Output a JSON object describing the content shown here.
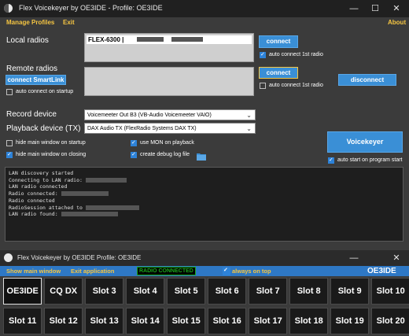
{
  "window1": {
    "title": "Flex Voicekeyer by OE3IDE - Profile: OE3IDE",
    "menu": {
      "manage_profiles": "Manage Profiles",
      "exit": "Exit",
      "about": "About"
    },
    "local_radios": {
      "label": "Local radios",
      "radio_entry": "FLEX-6300 |",
      "connect_label": "connect",
      "auto_connect_label": "auto connect 1st radio",
      "auto_connect_checked": true
    },
    "remote_radios": {
      "label": "Remote radios",
      "smartlink_label": "connect SmartLink",
      "auto_connect_startup_label": "auto connect on startup",
      "auto_connect_startup_checked": false,
      "connect_label": "connect",
      "auto_connect_label": "auto connect 1st radio",
      "auto_connect_checked": false,
      "disconnect_label": "disconnect"
    },
    "record_device": {
      "label": "Record device",
      "value": "Voicemeeter Out B3 (VB-Audio Voicemeeter VAIO)"
    },
    "playback_device": {
      "label": "Playback device (TX)",
      "value": "DAX Audio TX (FlexRadio Systems DAX TX)"
    },
    "options": {
      "hide_startup": {
        "label": "hide main window on startup",
        "checked": false
      },
      "hide_closing": {
        "label": "hide main window on closing",
        "checked": true
      },
      "use_mon": {
        "label": "use MON on playback",
        "checked": true
      },
      "debug_log": {
        "label": "create debug log file",
        "checked": true
      }
    },
    "voicekeyer_button": "Voicekeyer",
    "auto_start_label": "auto start on program start",
    "auto_start_checked": true,
    "log_lines": [
      "LAN discovery started",
      "Connecting to LAN radio:",
      "LAN radio connected",
      "Radio connected:",
      "Radio connected",
      "RadioSession attached to",
      "LAN radio found:"
    ]
  },
  "window2": {
    "title": "Flex Voicekeyer by OE3IDE Profile: OE3IDE",
    "show_main_window": "Show main window",
    "exit_application": "Exit application",
    "status": "RADIO CONNECTED",
    "always_on_top_label": "always on top",
    "always_on_top_checked": true,
    "callsign": "OE3IDE",
    "slots_row1": [
      "OE3IDE",
      "CQ DX",
      "Slot 3",
      "Slot 4",
      "Slot 5",
      "Slot 6",
      "Slot 7",
      "Slot 8",
      "Slot 9",
      "Slot 10"
    ],
    "slots_row2": [
      "Slot 11",
      "Slot 12",
      "Slot 13",
      "Slot 14",
      "Slot 15",
      "Slot 16",
      "Slot 17",
      "Slot 18",
      "Slot 19",
      "Slot 20"
    ]
  },
  "colors": {
    "accent_blue": "#3a8fd6",
    "menu_yellow": "#f5c542",
    "status_green": "#1aa81a",
    "bar_blue": "#2e78c5"
  }
}
